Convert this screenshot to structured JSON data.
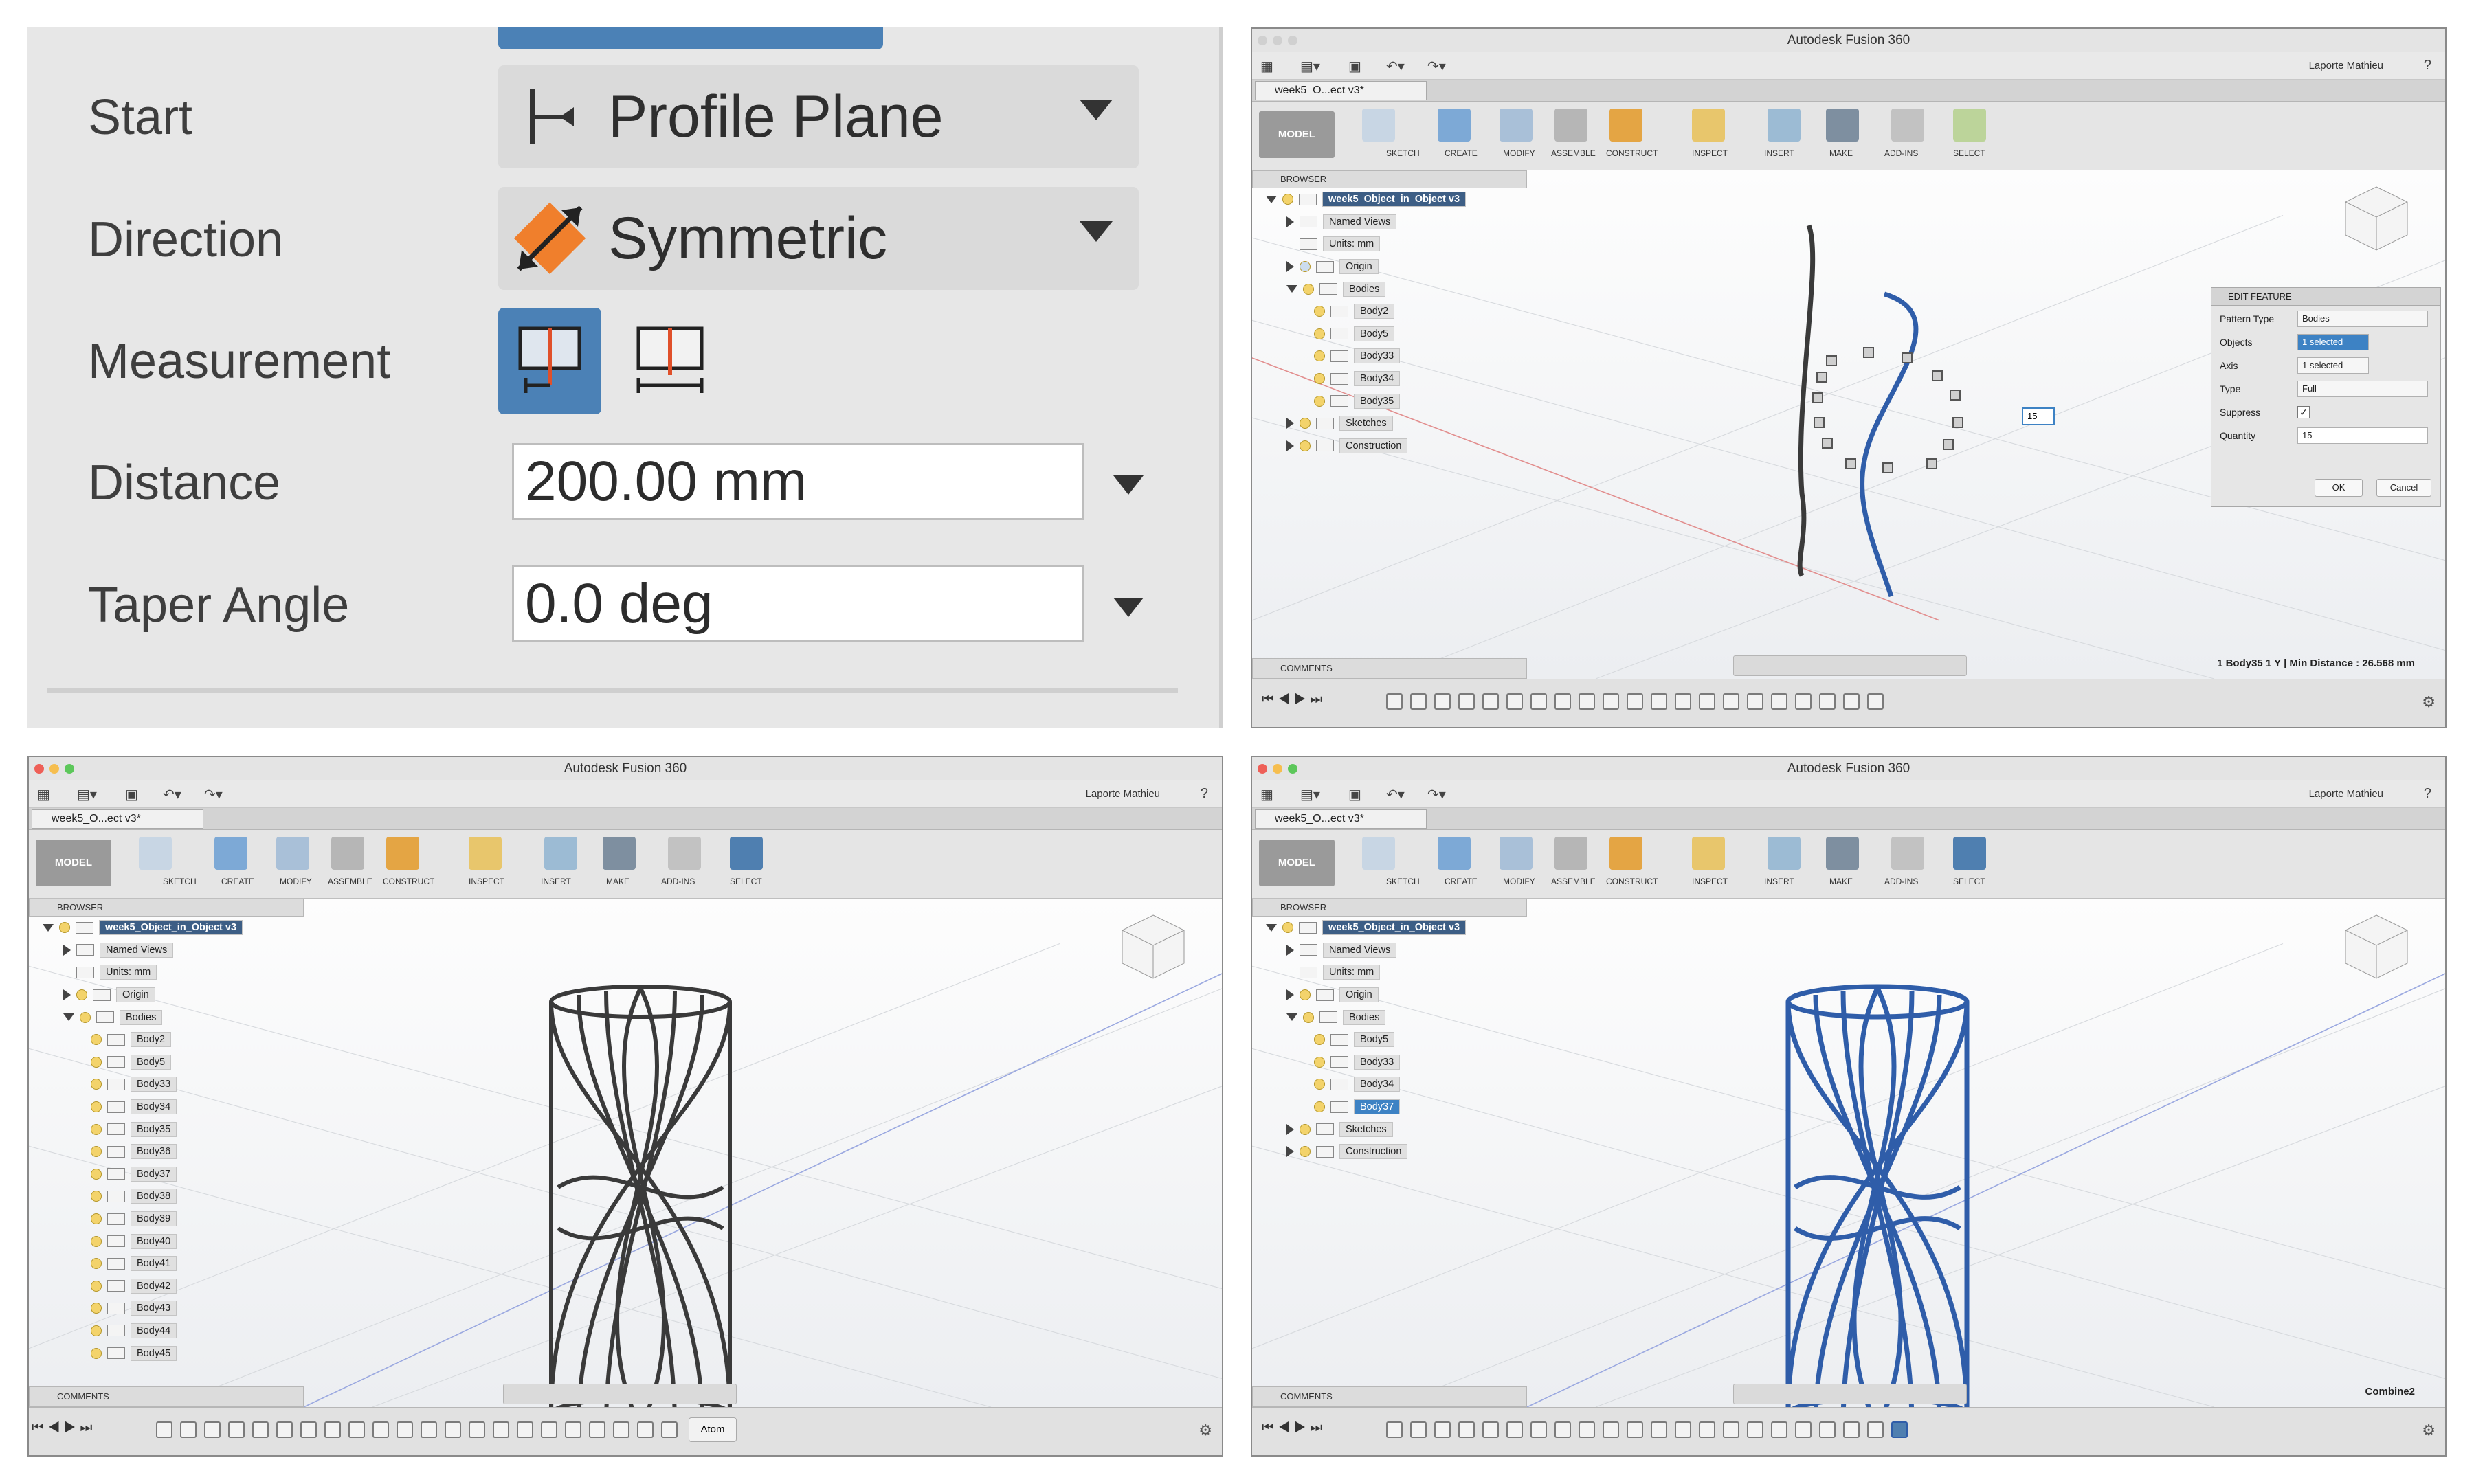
{
  "extrude": {
    "rows": [
      {
        "label": "Start",
        "value": "Profile Plane"
      },
      {
        "label": "Direction",
        "value": "Symmetric"
      },
      {
        "label": "Measurement"
      },
      {
        "label": "Distance",
        "value": "200.00 mm"
      },
      {
        "label": "Taper Angle",
        "value": "0.0 deg"
      }
    ]
  },
  "app": {
    "title": "Autodesk Fusion 360",
    "user": "Laporte Mathieu",
    "tab": "week5_O...ect v3*",
    "model_label": "MODEL",
    "tools": [
      "SKETCH",
      "CREATE",
      "MODIFY",
      "ASSEMBLE",
      "CONSTRUCT",
      "INSPECT",
      "INSERT",
      "MAKE",
      "ADD-INS",
      "SELECT"
    ],
    "browser_label": "BROWSER",
    "comments_label": "COMMENTS",
    "root_node": "week5_Object_in_Object v3",
    "named_views": "Named Views",
    "units": "Units: mm",
    "origin": "Origin",
    "bodies": "Bodies",
    "sketches": "Sketches",
    "construction": "Construction"
  },
  "win_a": {
    "bodies": [
      "Body2",
      "Body5",
      "Body33",
      "Body34",
      "Body35"
    ],
    "status": "1 Body35 1 Y | Min Distance : 26.568 mm",
    "dialog": {
      "title": "EDIT FEATURE",
      "rows": [
        {
          "label": "Pattern Type",
          "value": "Bodies"
        },
        {
          "label": "Objects",
          "value": "1 selected"
        },
        {
          "label": "Axis",
          "value": "1 selected"
        },
        {
          "label": "Type",
          "value": "Full"
        },
        {
          "label": "Suppress",
          "value": ""
        },
        {
          "label": "Quantity",
          "value": "15"
        }
      ],
      "ok": "OK",
      "cancel": "Cancel",
      "field_value": "15"
    }
  },
  "win_b": {
    "bodies": [
      "Body2",
      "Body5",
      "Body33",
      "Body34",
      "Body35",
      "Body36",
      "Body37",
      "Body38",
      "Body39",
      "Body40",
      "Body41",
      "Body42",
      "Body43",
      "Body44",
      "Body45"
    ],
    "tooltip": "Atom"
  },
  "win_c": {
    "bodies": [
      "Body5",
      "Body33",
      "Body34",
      "Body37"
    ],
    "status": "Combine2"
  },
  "colors": {
    "selected_blue": "#2f5da9",
    "body_dark": "#3a3a3a",
    "accent_blue": "#4f7fb0"
  }
}
